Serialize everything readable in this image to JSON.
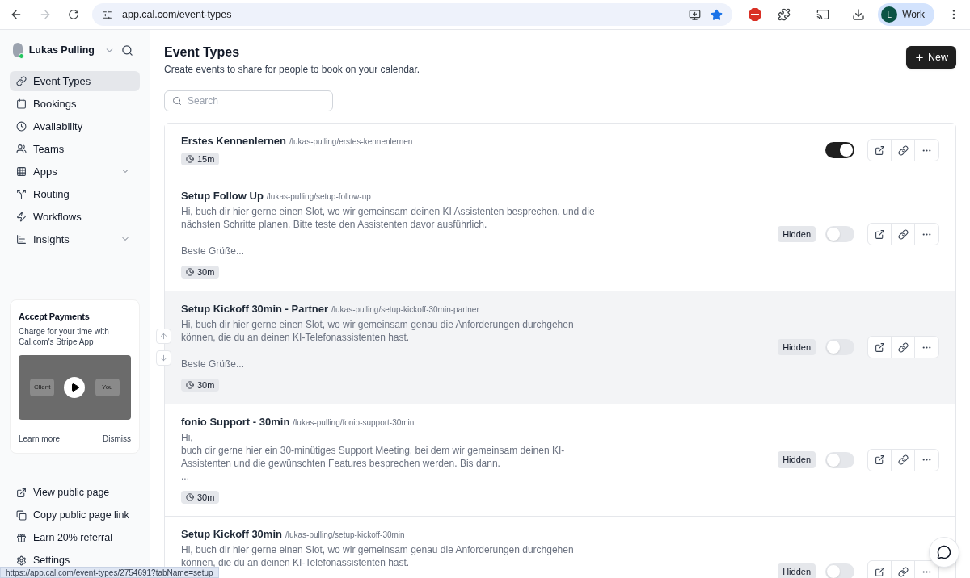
{
  "browser": {
    "url": "app.cal.com/event-types",
    "profile_initial": "L",
    "profile_name": "Work",
    "forward_disabled": true
  },
  "sidebar": {
    "user": "Lukas Pulling",
    "items": [
      {
        "label": "Event Types",
        "selected": true,
        "kind": "link"
      },
      {
        "label": "Bookings",
        "selected": false,
        "kind": "link"
      },
      {
        "label": "Availability",
        "selected": false,
        "kind": "link"
      },
      {
        "label": "Teams",
        "selected": false,
        "kind": "link"
      },
      {
        "label": "Apps",
        "selected": false,
        "kind": "group"
      },
      {
        "label": "Routing",
        "selected": false,
        "kind": "link"
      },
      {
        "label": "Workflows",
        "selected": false,
        "kind": "link"
      },
      {
        "label": "Insights",
        "selected": false,
        "kind": "group"
      }
    ],
    "promo": {
      "title": "Accept Payments",
      "text": "Charge for your time with Cal.com's Stripe App",
      "video_labels": [
        "Client",
        "You"
      ],
      "learn_more": "Learn more",
      "dismiss": "Dismiss"
    },
    "footer_items": [
      "View public page",
      "Copy public page link",
      "Earn 20% referral",
      "Settings"
    ]
  },
  "header": {
    "title": "Event Types",
    "subtitle": "Create events to share for people to book on your calendar.",
    "new_button": "New"
  },
  "search": {
    "placeholder": "Search"
  },
  "events": [
    {
      "title": "Erstes Kennenlernen",
      "slug": "/lukas-pulling/erstes-kennenlernen",
      "duration": "15m",
      "on": true,
      "highlighted": false
    },
    {
      "title": "Setup Follow Up",
      "slug": "/lukas-pulling/setup-follow-up",
      "description": [
        [
          "Hi, buch dir hier gerne einen Slot, wo wir gemeinsam deinen KI Assistenten besprechen, und die nächsten Schritte planen. Bitte teste den Assistenten davor ausführlich."
        ],
        [
          "Beste Grüße..."
        ]
      ],
      "duration": "30m",
      "badge": "Hidden",
      "on": false,
      "highlighted": false
    },
    {
      "title": "Setup Kickoff 30min - Partner",
      "slug": "/lukas-pulling/setup-kickoff-30min-partner",
      "description": [
        [
          "Hi, buch dir hier gerne einen Slot, wo wir gemeinsam genau die Anforderungen durchgehen können, die du an deinen KI-Telefonassistenten hast."
        ],
        [
          "Beste Grüße..."
        ]
      ],
      "duration": "30m",
      "badge": "Hidden",
      "on": false,
      "highlighted": true
    },
    {
      "title": "fonio Support - 30min",
      "slug": "/lukas-pulling/fonio-support-30min",
      "description": [
        [
          "Hi,",
          "buch dir gerne hier ein 30-minütiges Support Meeting, bei dem wir gemeinsam deinen KI-Assistenten und die gewünschten Features besprechen werden. Bis dann.",
          "..."
        ]
      ],
      "duration": "30m",
      "badge": "Hidden",
      "on": false,
      "highlighted": false
    },
    {
      "title": "Setup Kickoff 30min",
      "slug": "/lukas-pulling/setup-kickoff-30min",
      "description": [
        [
          "Hi, buch dir hier gerne einen Slot, wo wir gemeinsam genau die Anforderungen durchgehen können, die du an deinen KI-Telefonassistenten hast."
        ]
      ],
      "badge": "Hidden",
      "on": false,
      "highlighted": false
    }
  ],
  "status_bar": "https://app.cal.com/event-types/2754691?tabName=setup"
}
